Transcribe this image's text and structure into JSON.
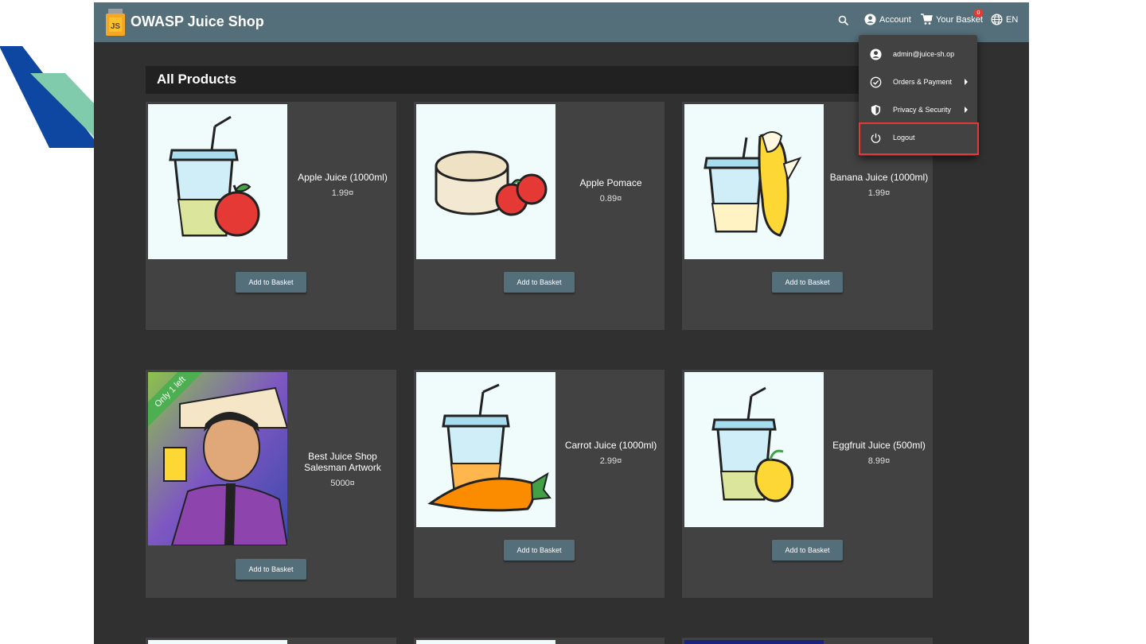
{
  "app": {
    "title": "OWASP Juice Shop"
  },
  "toolbar": {
    "search_icon": "search-icon",
    "account_label": "Account",
    "basket_label": "Your Basket",
    "basket_count": "0",
    "language_label": "EN"
  },
  "page": {
    "heading": "All Products"
  },
  "products": [
    {
      "name": "Apple Juice (1000ml)",
      "price": "1.99¤",
      "button": "Add to Basket"
    },
    {
      "name": "Apple Pomace",
      "price": "0.89¤",
      "button": "Add to Basket"
    },
    {
      "name": "Banana Juice (1000ml)",
      "price": "1.99¤",
      "button": "Add to Basket"
    },
    {
      "name": "Best Juice Shop Salesman Artwork",
      "price": "5000¤",
      "button": "Add to Basket",
      "ribbon": "Only 1 left"
    },
    {
      "name": "Carrot Juice (1000ml)",
      "price": "2.99¤",
      "button": "Add to Basket"
    },
    {
      "name": "Eggfruit Juice (500ml)",
      "price": "8.99¤",
      "button": "Add to Basket"
    }
  ],
  "account_menu": {
    "items": [
      {
        "label": "admin@juice-sh.op",
        "icon": "account-circle-icon"
      },
      {
        "label": "Orders & Payment",
        "icon": "check-circle-icon"
      },
      {
        "label": "Privacy & Security",
        "icon": "shield-icon"
      },
      {
        "label": "Logout",
        "icon": "power-icon"
      }
    ]
  },
  "colors": {
    "toolbar": "#546e7a",
    "background": "#303030",
    "card": "#424242",
    "ribbon": "#4caf50",
    "highlight": "#e53935"
  }
}
